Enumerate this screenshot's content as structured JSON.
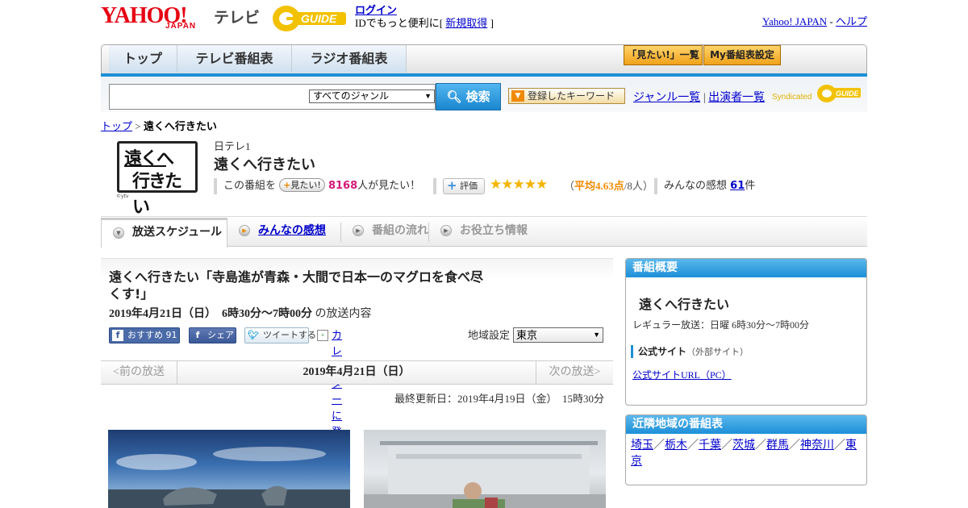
{
  "header": {
    "logo_yahoo": "YAHOO!",
    "logo_japan": "JAPAN",
    "logo_tv": "テレビ",
    "logo_guide": "GUIDE",
    "login_label": "ログイン",
    "login_sub_prefix": "IDでもっと便利に[",
    "signup_label": "新規取得",
    "login_sub_suffix": "]",
    "yahoo_japan_link": "Yahoo! JAPAN",
    "separator": "-",
    "help_link": "ヘルプ"
  },
  "nav": {
    "tabs": [
      "トップ",
      "テレビ番組表",
      "ラジオ番組表"
    ],
    "mitai_list": "「見たい!」一覧",
    "my_bangumi": "My番組表設定"
  },
  "search": {
    "placeholder": "",
    "genre_selected": "すべてのジャンル",
    "button": "検索",
    "registered_keywords": "登録したキーワード",
    "genre_list": "ジャンル一覧",
    "divider": "|",
    "performer_list": "出演者一覧",
    "syndicated": "Syndicated",
    "syndicated_guide": "GUIDE"
  },
  "breadcrumb": {
    "top": "トップ",
    "sep": ">",
    "current": "遠くへ行きたい"
  },
  "program": {
    "logo_line1": "遠くへ",
    "logo_line2": "行きたい",
    "logo_credit": "©ytv",
    "channel": "日テレ1",
    "title": "遠くへ行きたい",
    "watch_prefix": "この番組を",
    "mitai_button": "見たい!",
    "mitai_count": "8168",
    "watch_suffix": "人が見たい！",
    "rating_button": "評価",
    "stars": "★★★★★",
    "avg_prefix": "（",
    "avg_value": "平均4.63点",
    "avg_suffix": "/8人）",
    "impressions_label": "みんなの感想",
    "impressions_count": "61",
    "impressions_unit": "件",
    "rating_value": 4.63,
    "rating_max": 5
  },
  "tabs": {
    "schedule": "放送スケジュール",
    "impressions": "みんなの感想",
    "flow": "番組の流れ",
    "useful": "お役立ち情報"
  },
  "episode": {
    "title": "遠くへ行きたい「寺島進が青森・大間で日本一のマグロを食べ尽くす!」",
    "date_time": "2019年4月21日（日）　6時30分～7時00分",
    "date_suffix": "の放送内容",
    "fb_recommend": "おすすめ",
    "fb_count": "91",
    "fb_share": "シェア",
    "tweet": "ツイートする",
    "calendar": "カレンダーに登録",
    "region_label": "地域設定",
    "region_selected": "東京"
  },
  "date_nav": {
    "prev": "<前の放送",
    "current": "2019年4月21日（日）",
    "next": "次の放送>"
  },
  "updated": "最終更新日：2019年4月19日（金）　15時30分",
  "sidebar": {
    "overview": {
      "header": "番組概要",
      "title": "遠くへ行きたい",
      "regular": "レギュラー放送：日曜 6時30分～7時00分",
      "official_label": "公式サイト",
      "official_note": "（外部サイト）",
      "official_link": "公式サイトURL（PC）"
    },
    "nearby": {
      "header": "近隣地域の番組表",
      "regions": [
        "埼玉",
        "栃木",
        "千葉",
        "茨城",
        "群馬",
        "神奈川",
        "東京"
      ],
      "sep": "／"
    }
  },
  "colors": {
    "accent_blue": "#1d8fd8",
    "yahoo_red": "#e60012",
    "star_gold": "#f5b400",
    "pink": "#d21b7a"
  }
}
